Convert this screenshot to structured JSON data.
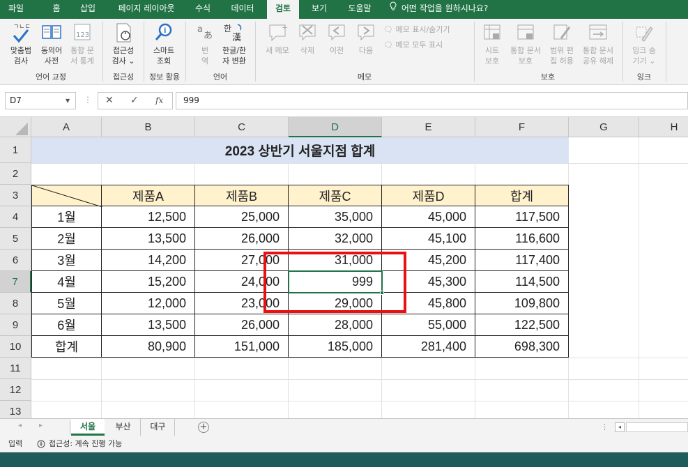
{
  "menu": {
    "tabs": [
      "파일",
      "홈",
      "삽입",
      "페이지 레이아웃",
      "수식",
      "데이터",
      "검토",
      "보기",
      "도움말"
    ],
    "active_tab": "검토",
    "tell_me": "어떤 작업을 원하시나요?"
  },
  "ribbon": {
    "groups": {
      "proofing": "언어 교정",
      "accessibility": "접근성",
      "insights": "정보 활용",
      "language": "언어",
      "comments": "메모",
      "protect": "보호",
      "ink": "잉크"
    },
    "buttons": {
      "spelling_1": "맞춤법",
      "spelling_2": "검사",
      "thesaurus_1": "동의어",
      "thesaurus_2": "사전",
      "workbook_stats_1": "통합 문",
      "workbook_stats_2": "서 통계",
      "check_access_1": "접근성",
      "check_access_2": "검사 ⌄",
      "smart_lookup_1": "스마트",
      "smart_lookup_2": "조회",
      "translate_1": "번",
      "translate_2": "역",
      "hanja_1": "한글/한",
      "hanja_2": "자 변환",
      "new_comment": "새 메모",
      "delete": "삭제",
      "previous": "이전",
      "next": "다음",
      "show_hide_comment": "메모 표시/숨기기",
      "show_all_comments": "메모 모두 표시",
      "protect_sheet_1": "시트",
      "protect_sheet_2": "보호",
      "protect_workbook_1": "통합 문서",
      "protect_workbook_2": "보호",
      "allow_edit_1": "범위 편",
      "allow_edit_2": "집 허용",
      "share_workbook_1": "통합 문서",
      "share_workbook_2": "공유 해제",
      "hide_ink_1": "잉크 숨",
      "hide_ink_2": "기기 ⌄"
    }
  },
  "formula_bar": {
    "name_box": "D7",
    "formula": "999",
    "cancel_glyph": "✕",
    "enter_glyph": "✓",
    "fx_glyph": "fx"
  },
  "grid": {
    "columns": [
      "A",
      "B",
      "C",
      "D",
      "E",
      "F",
      "G",
      "H"
    ],
    "rows": [
      "1",
      "2",
      "3",
      "4",
      "5",
      "6",
      "7",
      "8",
      "9",
      "10",
      "11",
      "12",
      "13"
    ],
    "selected_cell": "D7",
    "title": "2023 상반기 서울지점 합계",
    "headers": [
      "제품A",
      "제품B",
      "제품C",
      "제품D",
      "합계"
    ],
    "body": [
      [
        "1월",
        "12,500",
        "25,000",
        "35,000",
        "45,000",
        "117,500"
      ],
      [
        "2월",
        "13,500",
        "26,000",
        "32,000",
        "45,100",
        "116,600"
      ],
      [
        "3월",
        "14,200",
        "27,000",
        "31,000",
        "45,200",
        "117,400"
      ],
      [
        "4월",
        "15,200",
        "24,000",
        "999",
        "45,300",
        "114,500"
      ],
      [
        "5월",
        "12,000",
        "23,000",
        "29,000",
        "45,800",
        "109,800"
      ],
      [
        "6월",
        "13,500",
        "26,000",
        "28,000",
        "55,000",
        "122,500"
      ],
      [
        "합계",
        "80,900",
        "151,000",
        "185,000",
        "281,400",
        "698,300"
      ]
    ],
    "colors": {
      "title_fill": "#dae3f3",
      "header_fill": "#fff2cc",
      "highlight_box": "#e81010",
      "selection": "#217346"
    }
  },
  "sheets": {
    "tabs": [
      "서울",
      "부산",
      "대구"
    ],
    "active": "서울",
    "add_glyph": "+"
  },
  "status": {
    "mode": "입력",
    "accessibility": "접근성: 계속 진행 가능"
  }
}
